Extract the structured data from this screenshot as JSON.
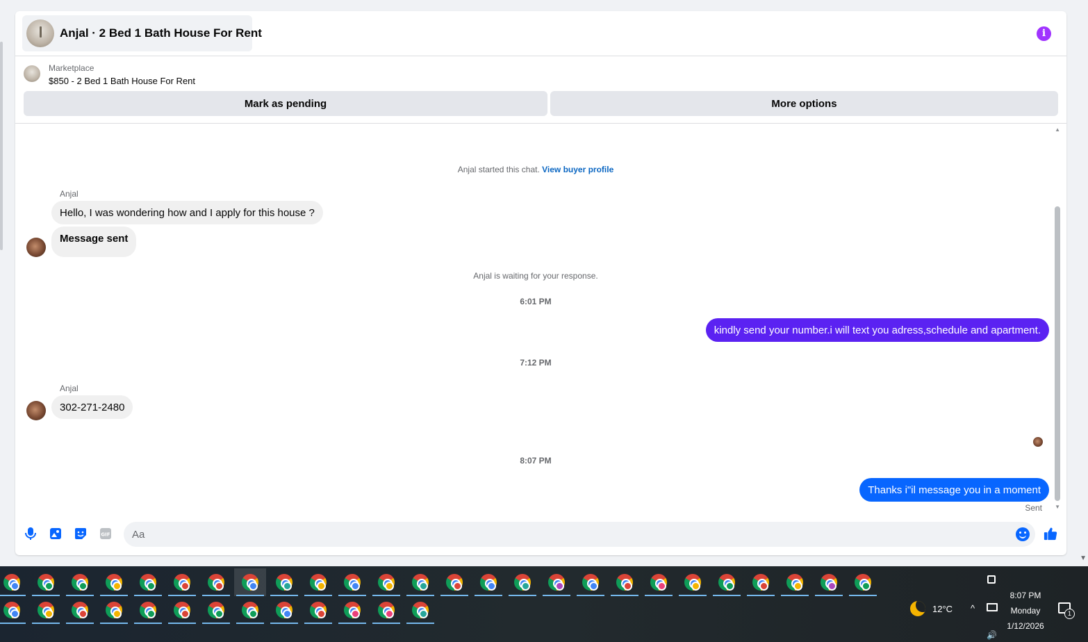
{
  "header": {
    "title": "Anjal · 2 Bed 1 Bath House For Rent",
    "info_icon": "info-icon"
  },
  "marketplace": {
    "label": "Marketplace",
    "listing": "$850 - 2 Bed 1 Bath House For Rent",
    "mark_pending_label": "Mark as pending",
    "more_options_label": "More options"
  },
  "messages": {
    "started_prefix": "Anjal started this chat.",
    "view_profile_link": "View buyer profile",
    "sender_1": "Anjal",
    "incoming_1": "Hello, I was wondering how and I apply for this house ?",
    "incoming_2": "Message sent",
    "waiting_notice": "Anjal is waiting for your response.",
    "time_1": "6:01 PM",
    "outgoing_1": "kindly send your number.i will text you adress,schedule and apartment.",
    "time_2": "7:12 PM",
    "sender_2": "Anjal",
    "incoming_3": "302-271-2480",
    "time_3": "8:07 PM",
    "outgoing_2": "Thanks i\"il message you in a moment",
    "status": "Sent",
    "colors": {
      "outgoing_1": "#5b22f2",
      "outgoing_2": "#0866ff"
    }
  },
  "composer": {
    "placeholder": "Aa",
    "icons": [
      "microphone-icon",
      "photo-icon",
      "sticker-icon",
      "gif-icon",
      "emoji-icon",
      "thumbs-up-icon"
    ],
    "gif_label": "GIF"
  },
  "taskbar": {
    "row1_count": 26,
    "row2_count": 13,
    "profile_colors": [
      "#4285f4",
      "#0f9d58",
      "#0f9d58",
      "#f4b400",
      "#0f9d58",
      "#db4437",
      "#db4437",
      "#4285f4",
      "#26a69a",
      "#f4b400",
      "#4285f4",
      "#f4b400",
      "#26a69a",
      "#db4437",
      "#4285f4",
      "#26a69a",
      "#ab47bc",
      "#4285f4",
      "#db4437",
      "#ec407a",
      "#f4b400",
      "#0f9d58",
      "#db4437",
      "#f4b400",
      "#ab47bc",
      "#0f9d58"
    ],
    "profile_colors_row2": [
      "#4285f4",
      "#f4b400",
      "#db4437",
      "#f4b400",
      "#0f9d58",
      "#db4437",
      "#0f9d58",
      "#0f9d58",
      "#4285f4",
      "#db4437",
      "#ec407a",
      "#ec407a",
      "#26a69a"
    ],
    "weather": "12°C",
    "time": "8:07 PM",
    "day": "Monday",
    "date": "1/12/2026",
    "notification_count": "1"
  }
}
